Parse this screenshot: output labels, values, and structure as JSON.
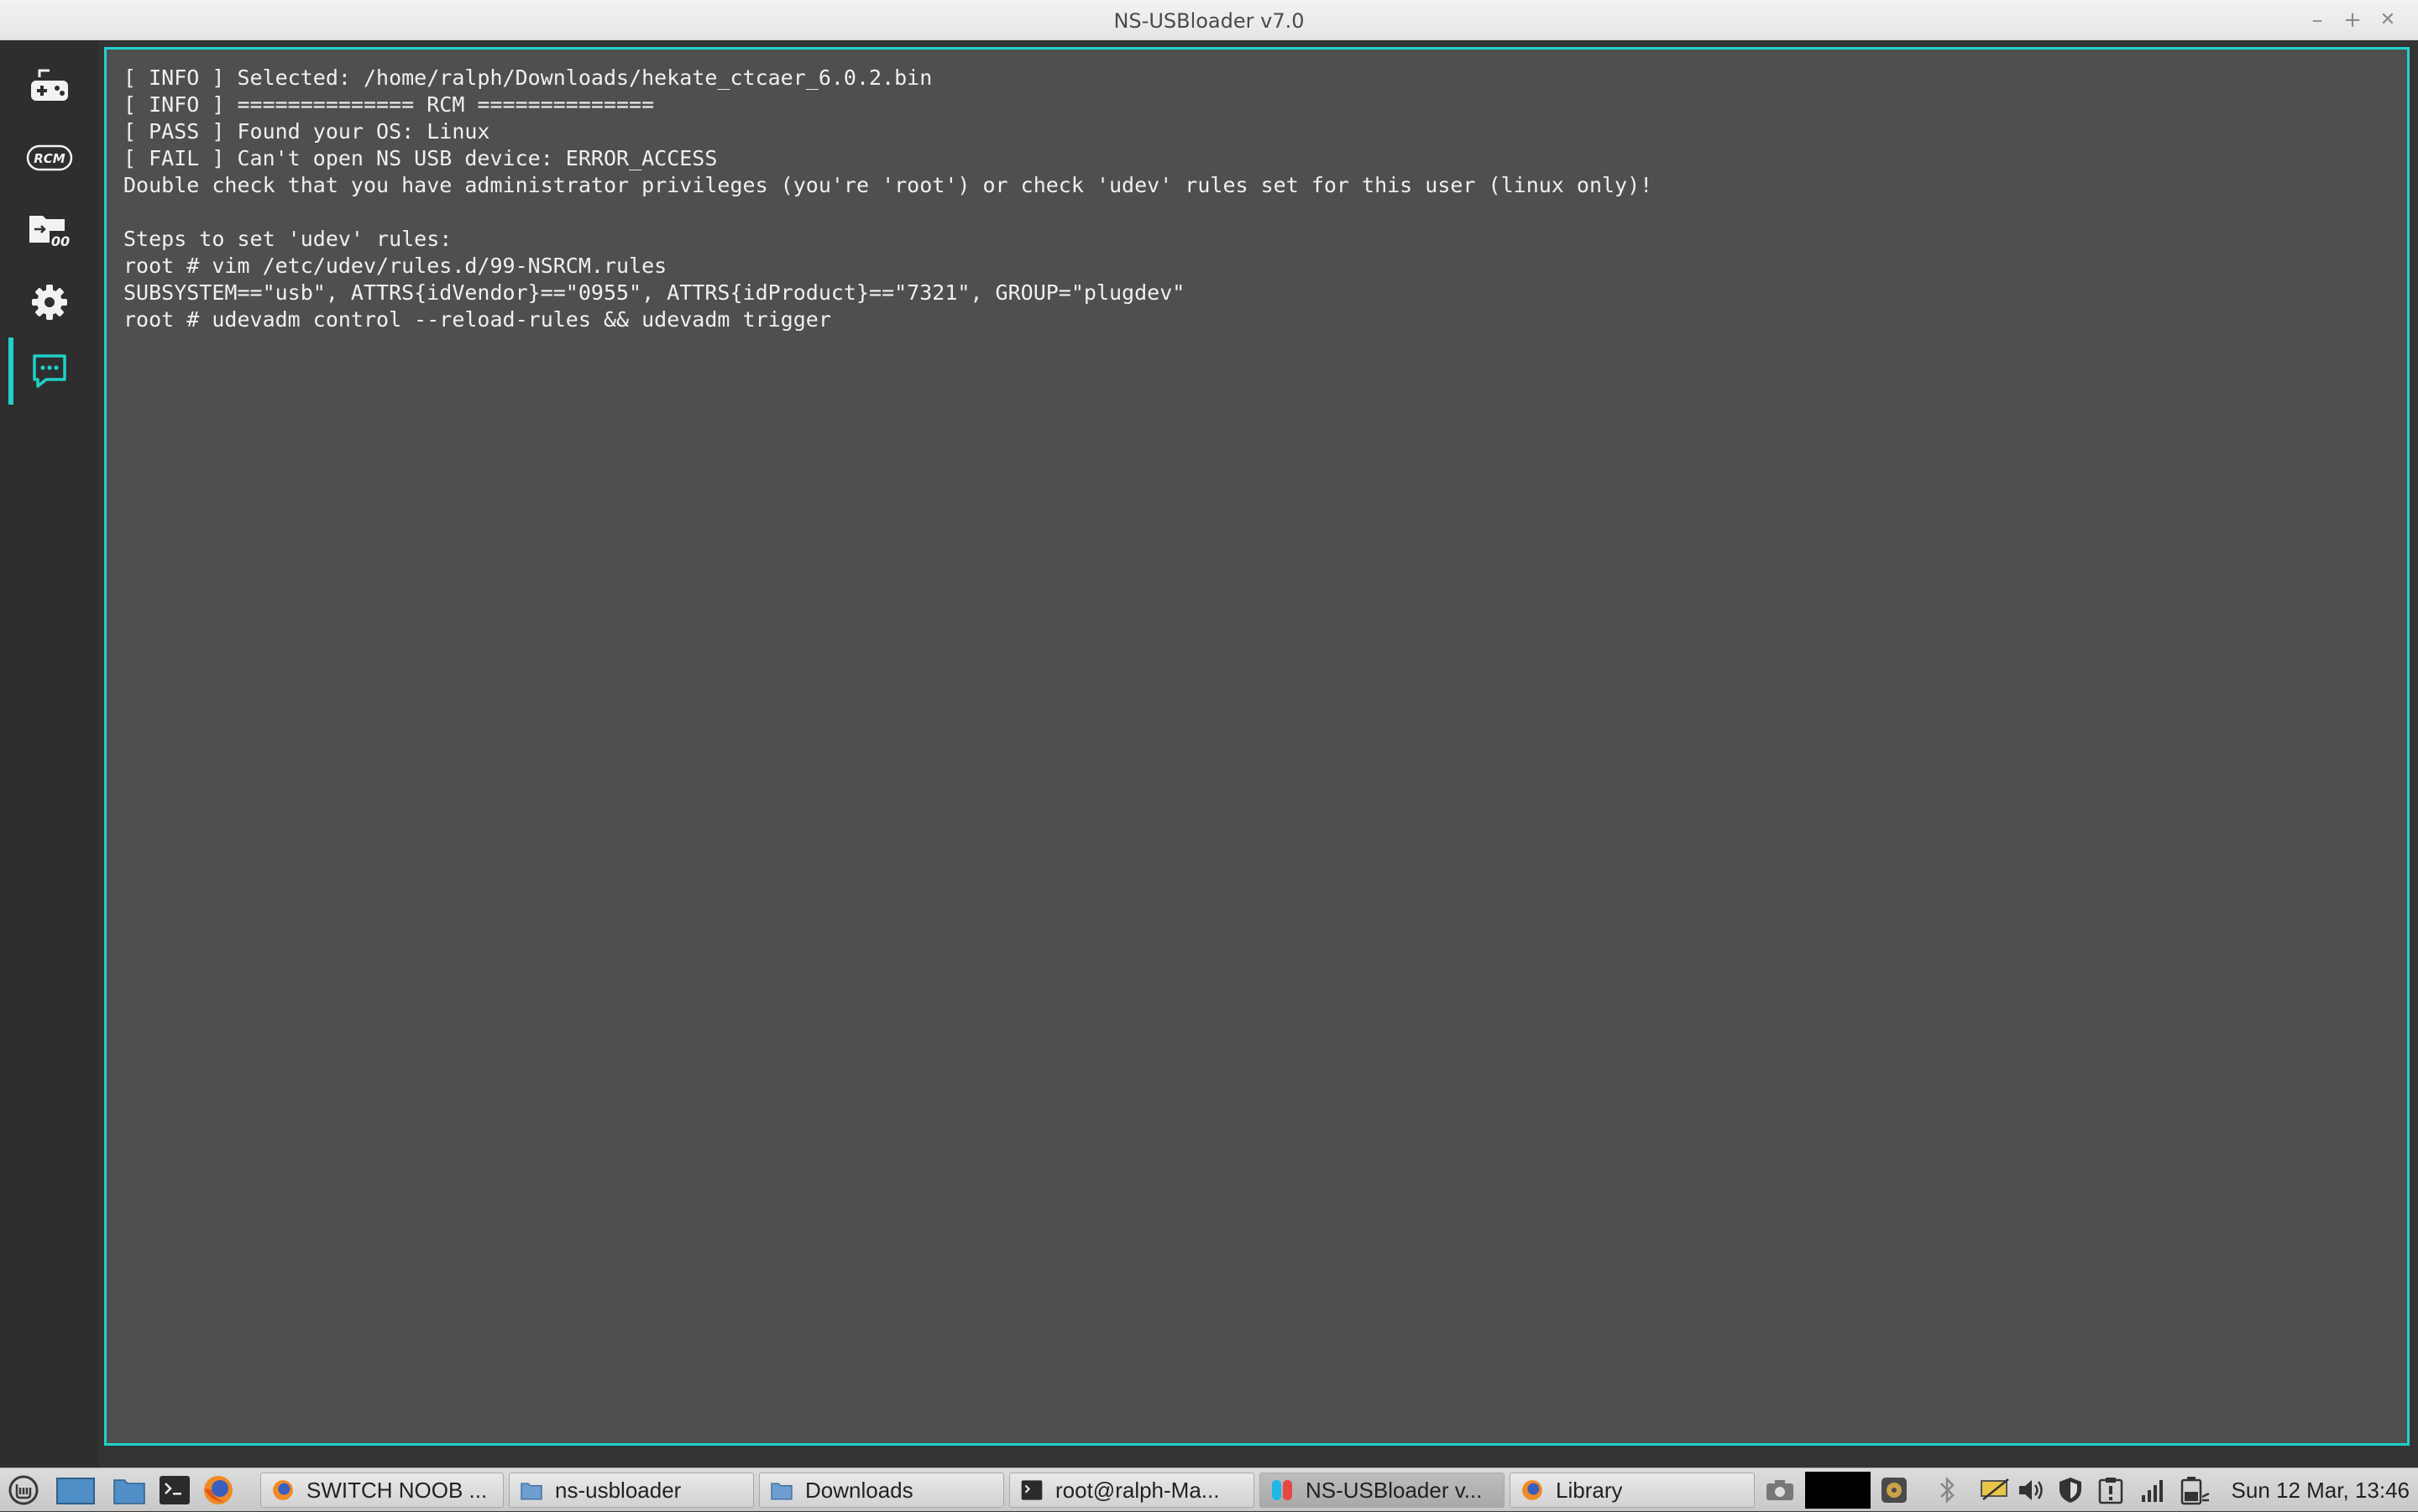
{
  "window": {
    "title": "NS-USBloader v7.0",
    "controls": {
      "minimize": "–",
      "maximize": "+",
      "close": "✕"
    }
  },
  "sidebar": {
    "items": [
      {
        "name": "gamepad",
        "icon": "gamepad-icon",
        "active": false
      },
      {
        "name": "rcm",
        "icon": "rcm-icon",
        "label": "RCM",
        "active": false
      },
      {
        "name": "split-merge",
        "icon": "folder-split-icon",
        "active": false
      },
      {
        "name": "settings",
        "icon": "gear-icon",
        "active": false
      },
      {
        "name": "logs",
        "icon": "chat-icon",
        "active": true
      }
    ]
  },
  "log": {
    "lines": [
      "[ INFO ] Selected: /home/ralph/Downloads/hekate_ctcaer_6.0.2.bin",
      "[ INFO ] ============== RCM ==============",
      "[ PASS ] Found your OS: Linux",
      "[ FAIL ] Can't open NS USB device: ERROR_ACCESS",
      "Double check that you have administrator privileges (you're 'root') or check 'udev' rules set for this user (linux only)!",
      "",
      "Steps to set 'udev' rules:",
      "root # vim /etc/udev/rules.d/99-NSRCM.rules",
      "SUBSYSTEM==\"usb\", ATTRS{idVendor}==\"0955\", ATTRS{idProduct}==\"7321\", GROUP=\"plugdev\"",
      "root # udevadm control --reload-rules && udevadm trigger"
    ]
  },
  "taskbar": {
    "launchers": [
      "mint-menu-icon",
      "show-desktop-icon",
      "files-icon",
      "terminal-icon",
      "firefox-icon"
    ],
    "tasks": [
      {
        "label": "SWITCH NOOB ...",
        "icon": "firefox-icon",
        "active": false
      },
      {
        "label": "ns-usbloader",
        "icon": "folder-icon",
        "active": false
      },
      {
        "label": "Downloads",
        "icon": "folder-icon",
        "active": false
      },
      {
        "label": "root@ralph-Ma...",
        "icon": "terminal-icon",
        "active": false
      },
      {
        "label": "NS-USBloader v...",
        "icon": "switch-icon",
        "active": true
      },
      {
        "label": "Library",
        "icon": "firefox-icon",
        "active": false
      }
    ],
    "tray": [
      "camera-icon",
      "workspace-icon",
      "audio-icon",
      "bluetooth-icon",
      "display-icon",
      "volume-icon",
      "shield-icon",
      "update-icon",
      "network-icon",
      "battery-icon"
    ],
    "clock": "Sun 12 Mar, 13:46"
  },
  "colors": {
    "accent": "#1fd1c9",
    "log_bg": "#4f4f4f",
    "sidebar_bg": "#2e2e2e"
  }
}
